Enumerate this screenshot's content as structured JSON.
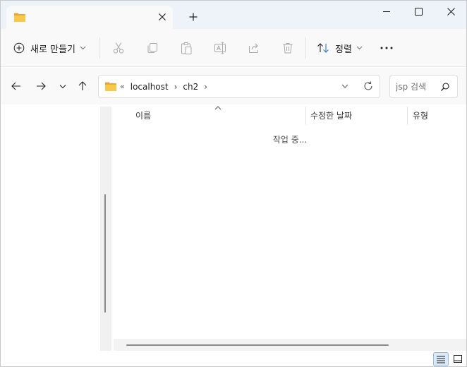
{
  "window": {
    "tab_icon": "folder-icon",
    "tab_close_icon": "close-icon",
    "new_tab_icon": "plus-icon",
    "controls": [
      "minimize-icon",
      "maximize-icon",
      "close-icon"
    ]
  },
  "toolbar": {
    "new_label": "새로 만들기",
    "sort_label": "정렬",
    "icons": [
      "cut-icon",
      "copy-icon",
      "paste-icon",
      "rename-icon",
      "share-icon",
      "delete-icon",
      "more-icon"
    ]
  },
  "address": {
    "overflow": "«",
    "crumbs": [
      "localhost",
      "ch2"
    ],
    "separator": "›"
  },
  "search": {
    "placeholder": "jsp 검색"
  },
  "columns": {
    "name": "이름",
    "date": "수정한 날짜",
    "type": "유형"
  },
  "content": {
    "loading": "작업 중..."
  },
  "colors": {
    "accent": "#2f7bd1",
    "folder": "#f4c24a",
    "titlebar": "#eef3f9",
    "toolbar": "#f9f9f9"
  }
}
